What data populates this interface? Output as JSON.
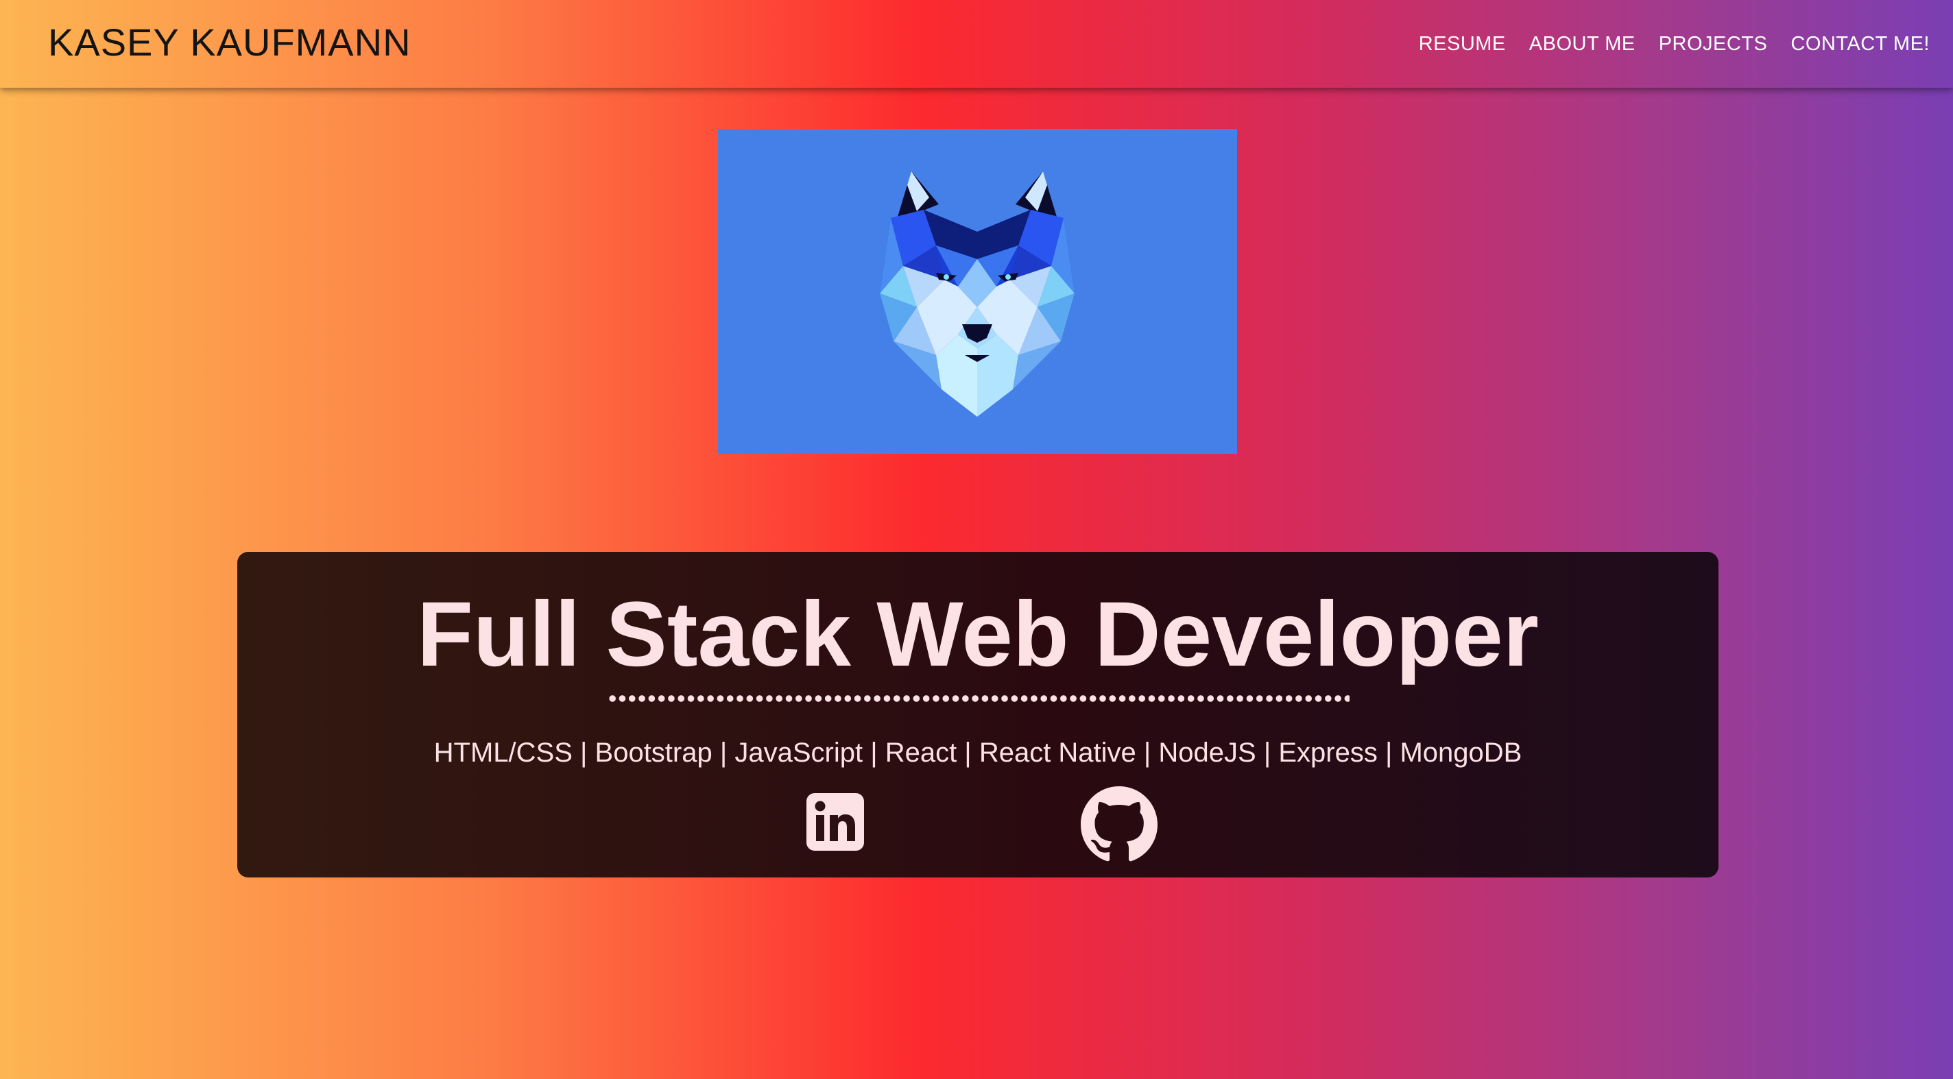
{
  "navbar": {
    "brand": "KASEY KAUFMANN",
    "links": [
      {
        "label": "RESUME"
      },
      {
        "label": "ABOUT ME"
      },
      {
        "label": "PROJECTS"
      },
      {
        "label": "CONTACT ME!"
      }
    ]
  },
  "hero": {
    "image": "wolf-low-poly-illustration",
    "background_color": "#4580e8"
  },
  "intro": {
    "headline": "Full Stack Web Developer",
    "skills": "HTML/CSS | Bootstrap | JavaScript | React | React Native | NodeJS | Express | MongoDB",
    "social": [
      {
        "icon": "linkedin-icon"
      },
      {
        "icon": "github-icon"
      }
    ]
  },
  "colors": {
    "gradient_start": "#fdb552",
    "gradient_mid": "#fd2a2e",
    "gradient_end": "#7a3fb4",
    "card_text": "#fde2e5"
  }
}
